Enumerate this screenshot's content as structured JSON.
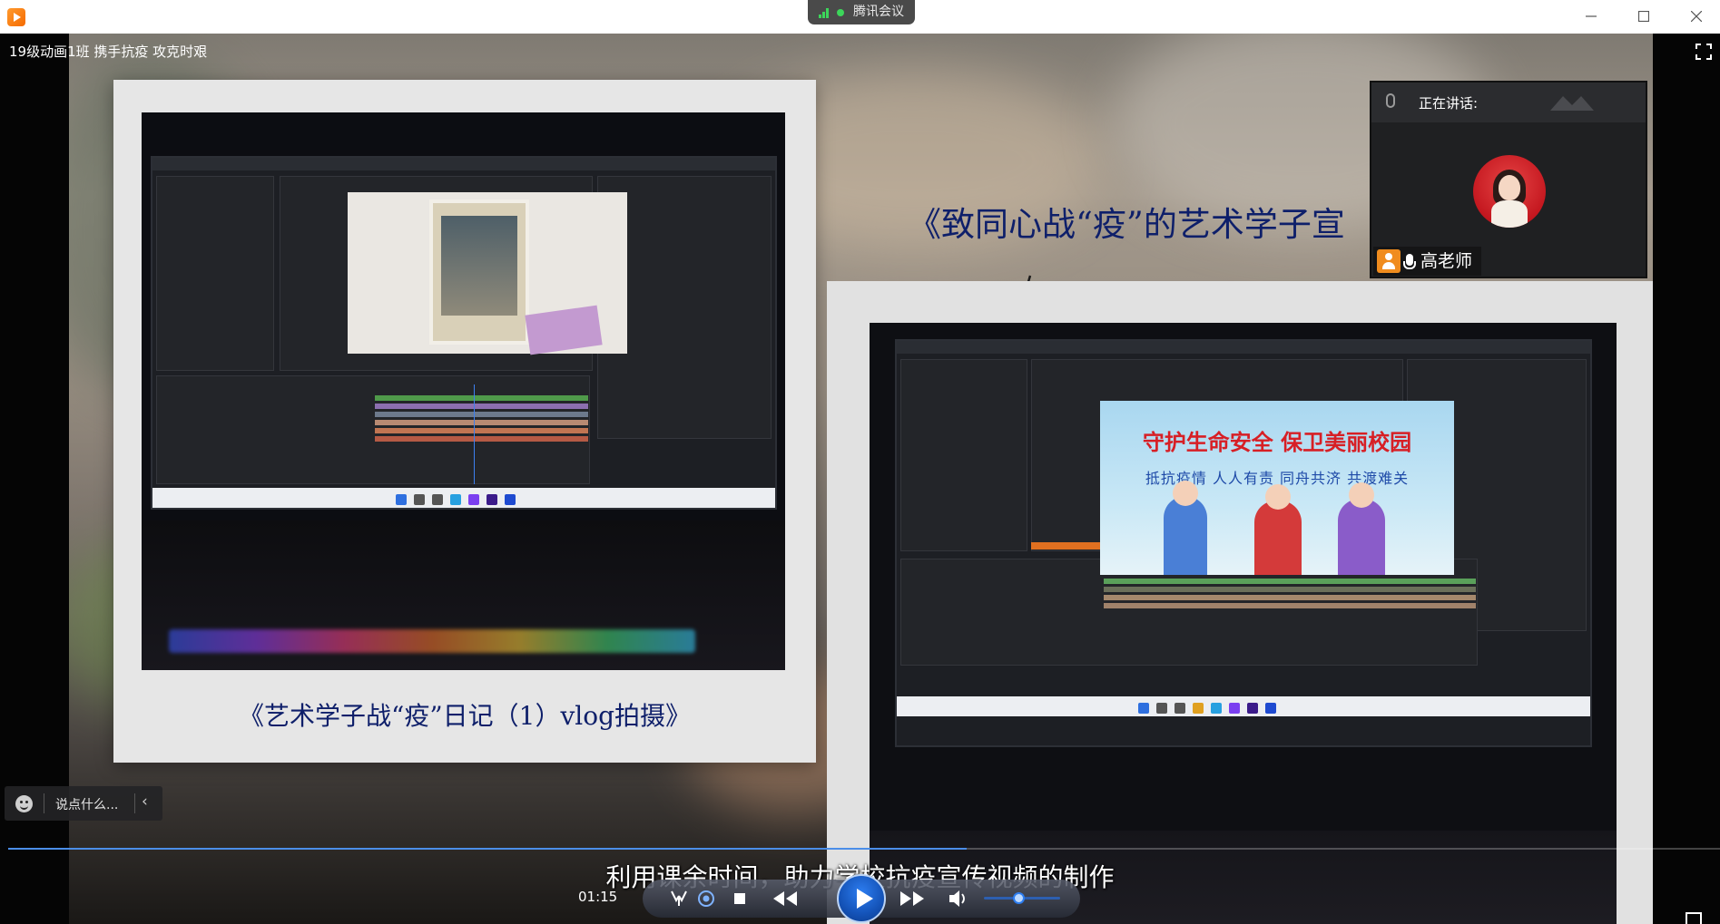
{
  "window": {
    "meeting_label": "腾讯会议",
    "min_icon": "minimize-icon",
    "max_icon": "maximize-icon",
    "close_icon": "close-icon"
  },
  "stage": {
    "title": "19级动画1班 携手抗疫   攻克时艰"
  },
  "video": {
    "left_caption": "《艺术学子战“疫”日记（1）vlog拍摄》",
    "right_title": "《致同心战“疫”的艺术学子宣",
    "campaign_headline": "守护生命安全  保卫美丽校园",
    "campaign_slogan": "抵抗疫情   人人有责   同舟共济   共渡难关",
    "subtitle": "利用课余时间，助力学校抗疫宣传视频的制作"
  },
  "speaker": {
    "label": "正在讲话:",
    "name": "高老师"
  },
  "chat": {
    "placeholder": "说点什么..."
  },
  "player": {
    "time": "01:15",
    "progress": 0.56,
    "volume": 0.45,
    "accent": "#2d7df0"
  }
}
